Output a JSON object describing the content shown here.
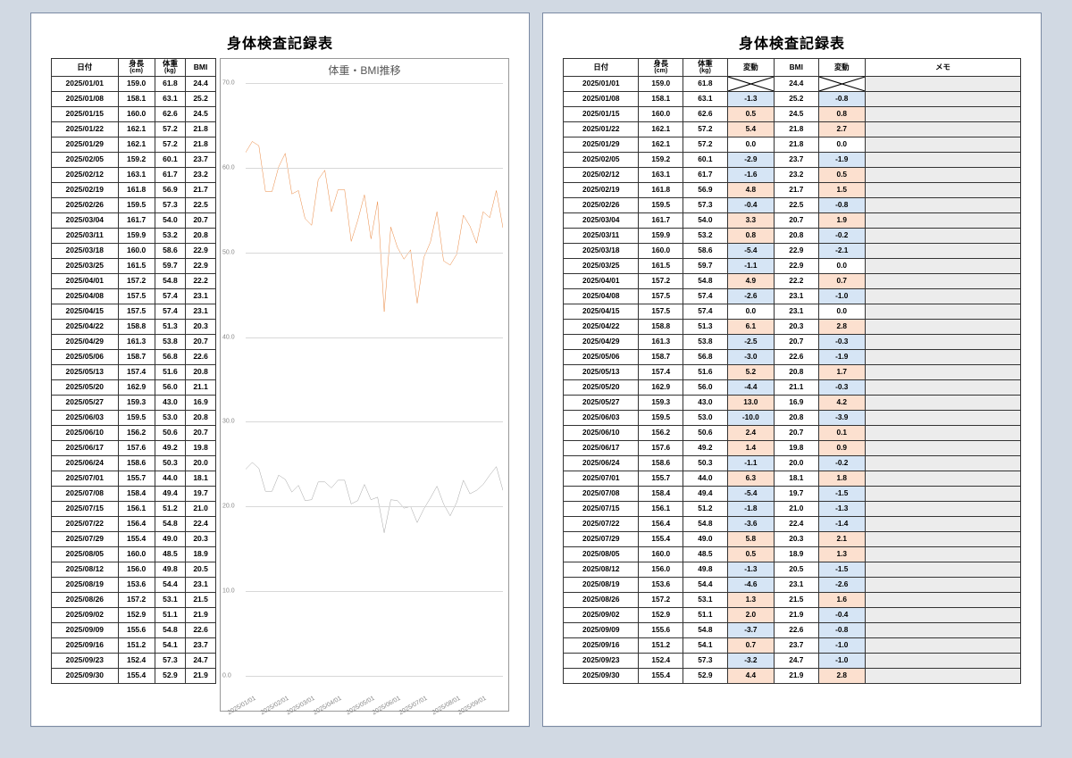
{
  "title": "身体検査記録表",
  "headers1": {
    "date": "日付",
    "height": "身長",
    "height_unit": "(cm)",
    "weight": "体重",
    "weight_unit": "(kg)",
    "bmi": "BMI"
  },
  "headers2": {
    "date": "日付",
    "height": "身長",
    "height_unit": "(cm)",
    "weight": "体重",
    "weight_unit": "(kg)",
    "diff_w": "変動",
    "bmi": "BMI",
    "diff_b": "変動",
    "memo": "メモ"
  },
  "chart_title": "体重・BMI推移",
  "chart_data": {
    "type": "line",
    "ylim": [
      0,
      70
    ],
    "yticks": [
      0,
      10,
      20,
      30,
      40,
      50,
      60,
      70
    ],
    "x_labels": [
      "2025/01/01",
      "2025/02/01",
      "2025/03/01",
      "2025/04/01",
      "2025/05/01",
      "2025/06/01",
      "2025/07/01",
      "2025/08/01",
      "2025/09/01"
    ],
    "series": [
      {
        "name": "体重",
        "color": "#e87b2b"
      },
      {
        "name": "BMI",
        "color": "#9a9a9a"
      }
    ]
  },
  "rows": [
    {
      "date": "2025/01/01",
      "h": 159.0,
      "w": 61.8,
      "bmi": 24.4,
      "dw": null,
      "db": null
    },
    {
      "date": "2025/01/08",
      "h": 158.1,
      "w": 63.1,
      "bmi": 25.2,
      "dw": -1.3,
      "db": -0.8
    },
    {
      "date": "2025/01/15",
      "h": 160.0,
      "w": 62.6,
      "bmi": 24.5,
      "dw": 0.5,
      "db": 0.8
    },
    {
      "date": "2025/01/22",
      "h": 162.1,
      "w": 57.2,
      "bmi": 21.8,
      "dw": 5.4,
      "db": 2.7
    },
    {
      "date": "2025/01/29",
      "h": 162.1,
      "w": 57.2,
      "bmi": 21.8,
      "dw": 0.0,
      "db": 0.0
    },
    {
      "date": "2025/02/05",
      "h": 159.2,
      "w": 60.1,
      "bmi": 23.7,
      "dw": -2.9,
      "db": -1.9
    },
    {
      "date": "2025/02/12",
      "h": 163.1,
      "w": 61.7,
      "bmi": 23.2,
      "dw": -1.6,
      "db": 0.5
    },
    {
      "date": "2025/02/19",
      "h": 161.8,
      "w": 56.9,
      "bmi": 21.7,
      "dw": 4.8,
      "db": 1.5
    },
    {
      "date": "2025/02/26",
      "h": 159.5,
      "w": 57.3,
      "bmi": 22.5,
      "dw": -0.4,
      "db": -0.8
    },
    {
      "date": "2025/03/04",
      "h": 161.7,
      "w": 54.0,
      "bmi": 20.7,
      "dw": 3.3,
      "db": 1.9
    },
    {
      "date": "2025/03/11",
      "h": 159.9,
      "w": 53.2,
      "bmi": 20.8,
      "dw": 0.8,
      "db": -0.2
    },
    {
      "date": "2025/03/18",
      "h": 160.0,
      "w": 58.6,
      "bmi": 22.9,
      "dw": -5.4,
      "db": -2.1
    },
    {
      "date": "2025/03/25",
      "h": 161.5,
      "w": 59.7,
      "bmi": 22.9,
      "dw": -1.1,
      "db": 0.0
    },
    {
      "date": "2025/04/01",
      "h": 157.2,
      "w": 54.8,
      "bmi": 22.2,
      "dw": 4.9,
      "db": 0.7
    },
    {
      "date": "2025/04/08",
      "h": 157.5,
      "w": 57.4,
      "bmi": 23.1,
      "dw": -2.6,
      "db": -1.0
    },
    {
      "date": "2025/04/15",
      "h": 157.5,
      "w": 57.4,
      "bmi": 23.1,
      "dw": 0.0,
      "db": 0.0
    },
    {
      "date": "2025/04/22",
      "h": 158.8,
      "w": 51.3,
      "bmi": 20.3,
      "dw": 6.1,
      "db": 2.8
    },
    {
      "date": "2025/04/29",
      "h": 161.3,
      "w": 53.8,
      "bmi": 20.7,
      "dw": -2.5,
      "db": -0.3
    },
    {
      "date": "2025/05/06",
      "h": 158.7,
      "w": 56.8,
      "bmi": 22.6,
      "dw": -3.0,
      "db": -1.9
    },
    {
      "date": "2025/05/13",
      "h": 157.4,
      "w": 51.6,
      "bmi": 20.8,
      "dw": 5.2,
      "db": 1.7
    },
    {
      "date": "2025/05/20",
      "h": 162.9,
      "w": 56.0,
      "bmi": 21.1,
      "dw": -4.4,
      "db": -0.3
    },
    {
      "date": "2025/05/27",
      "h": 159.3,
      "w": 43.0,
      "bmi": 16.9,
      "dw": 13.0,
      "db": 4.2
    },
    {
      "date": "2025/06/03",
      "h": 159.5,
      "w": 53.0,
      "bmi": 20.8,
      "dw": -10.0,
      "db": -3.9
    },
    {
      "date": "2025/06/10",
      "h": 156.2,
      "w": 50.6,
      "bmi": 20.7,
      "dw": 2.4,
      "db": 0.1
    },
    {
      "date": "2025/06/17",
      "h": 157.6,
      "w": 49.2,
      "bmi": 19.8,
      "dw": 1.4,
      "db": 0.9
    },
    {
      "date": "2025/06/24",
      "h": 158.6,
      "w": 50.3,
      "bmi": 20.0,
      "dw": -1.1,
      "db": -0.2
    },
    {
      "date": "2025/07/01",
      "h": 155.7,
      "w": 44.0,
      "bmi": 18.1,
      "dw": 6.3,
      "db": 1.8
    },
    {
      "date": "2025/07/08",
      "h": 158.4,
      "w": 49.4,
      "bmi": 19.7,
      "dw": -5.4,
      "db": -1.5
    },
    {
      "date": "2025/07/15",
      "h": 156.1,
      "w": 51.2,
      "bmi": 21.0,
      "dw": -1.8,
      "db": -1.3
    },
    {
      "date": "2025/07/22",
      "h": 156.4,
      "w": 54.8,
      "bmi": 22.4,
      "dw": -3.6,
      "db": -1.4
    },
    {
      "date": "2025/07/29",
      "h": 155.4,
      "w": 49.0,
      "bmi": 20.3,
      "dw": 5.8,
      "db": 2.1
    },
    {
      "date": "2025/08/05",
      "h": 160.0,
      "w": 48.5,
      "bmi": 18.9,
      "dw": 0.5,
      "db": 1.3
    },
    {
      "date": "2025/08/12",
      "h": 156.0,
      "w": 49.8,
      "bmi": 20.5,
      "dw": -1.3,
      "db": -1.5
    },
    {
      "date": "2025/08/19",
      "h": 153.6,
      "w": 54.4,
      "bmi": 23.1,
      "dw": -4.6,
      "db": -2.6
    },
    {
      "date": "2025/08/26",
      "h": 157.2,
      "w": 53.1,
      "bmi": 21.5,
      "dw": 1.3,
      "db": 1.6
    },
    {
      "date": "2025/09/02",
      "h": 152.9,
      "w": 51.1,
      "bmi": 21.9,
      "dw": 2.0,
      "db": -0.4
    },
    {
      "date": "2025/09/09",
      "h": 155.6,
      "w": 54.8,
      "bmi": 22.6,
      "dw": -3.7,
      "db": -0.8
    },
    {
      "date": "2025/09/16",
      "h": 151.2,
      "w": 54.1,
      "bmi": 23.7,
      "dw": 0.7,
      "db": -1.0
    },
    {
      "date": "2025/09/23",
      "h": 152.4,
      "w": 57.3,
      "bmi": 24.7,
      "dw": -3.2,
      "db": -1.0
    },
    {
      "date": "2025/09/30",
      "h": 155.4,
      "w": 52.9,
      "bmi": 21.9,
      "dw": 4.4,
      "db": 2.8
    }
  ]
}
